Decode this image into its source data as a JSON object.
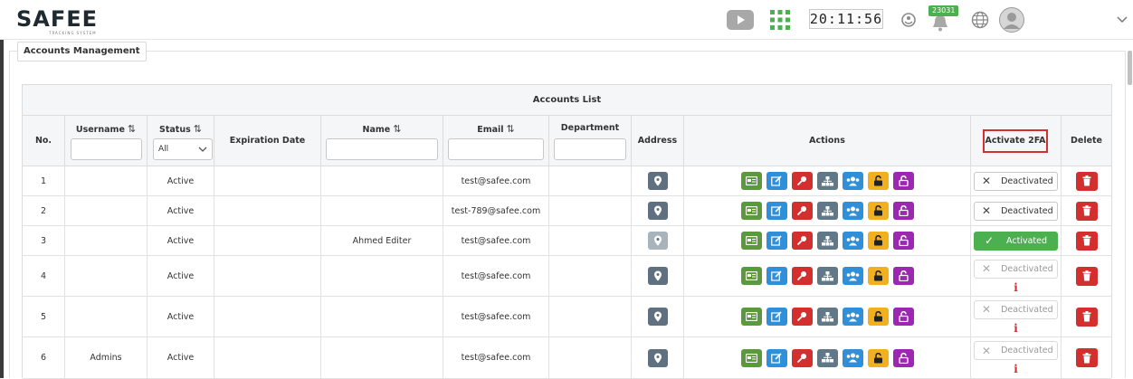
{
  "header": {
    "logo_text": "SAFEE",
    "logo_sub": "TRACKING SYSTEM",
    "clock": "20:11:56",
    "notifications_count": "23031"
  },
  "panel": {
    "tab_label": "Accounts Management"
  },
  "table": {
    "title": "Accounts List",
    "columns": {
      "no": "No.",
      "username": "Username",
      "status": "Status",
      "expiration": "Expiration Date",
      "name": "Name",
      "email": "Email",
      "department": "Department",
      "address": "Address",
      "actions": "Actions",
      "activate_2fa": "Activate 2FA",
      "delete": "Delete"
    },
    "sort_glyph": "⇅",
    "status_filter_value": "All",
    "rows": [
      {
        "no": "1",
        "username": "",
        "status": "Active",
        "expiration": "",
        "name": "",
        "email": "test@safee.com",
        "twofa": "Deactivated"
      },
      {
        "no": "2",
        "username": "",
        "status": "Active",
        "expiration": "",
        "name": "",
        "email": "test-789@safee.com",
        "twofa": "Deactivated"
      },
      {
        "no": "3",
        "username": "",
        "status": "Active",
        "expiration": "",
        "name": "Ahmed Editer",
        "email": "test@safee.com",
        "twofa": "Activated"
      },
      {
        "no": "4",
        "username": "",
        "status": "Active",
        "expiration": "",
        "name": "",
        "email": "test@safee.com",
        "twofa": "Deactivated"
      },
      {
        "no": "5",
        "username": "",
        "status": "Active",
        "expiration": "",
        "name": "",
        "email": "test@safee.com",
        "twofa": "Deactivated"
      },
      {
        "no": "6",
        "username": "Admins",
        "status": "Active",
        "expiration": "",
        "name": "",
        "email": "test@safee.com",
        "twofa": "Deactivated"
      }
    ],
    "info_glyph": "i"
  },
  "colors": {
    "action_card": "#5b9a3c",
    "action_edit": "#2f8fd8",
    "action_key": "#d32f2f",
    "action_hierarchy": "#607887",
    "action_users": "#2f8fd8",
    "action_unlock_yellow": "#f2b01e",
    "action_unlock_purple": "#9c27b0",
    "delete": "#d32f2f",
    "activated": "#4caf50"
  }
}
